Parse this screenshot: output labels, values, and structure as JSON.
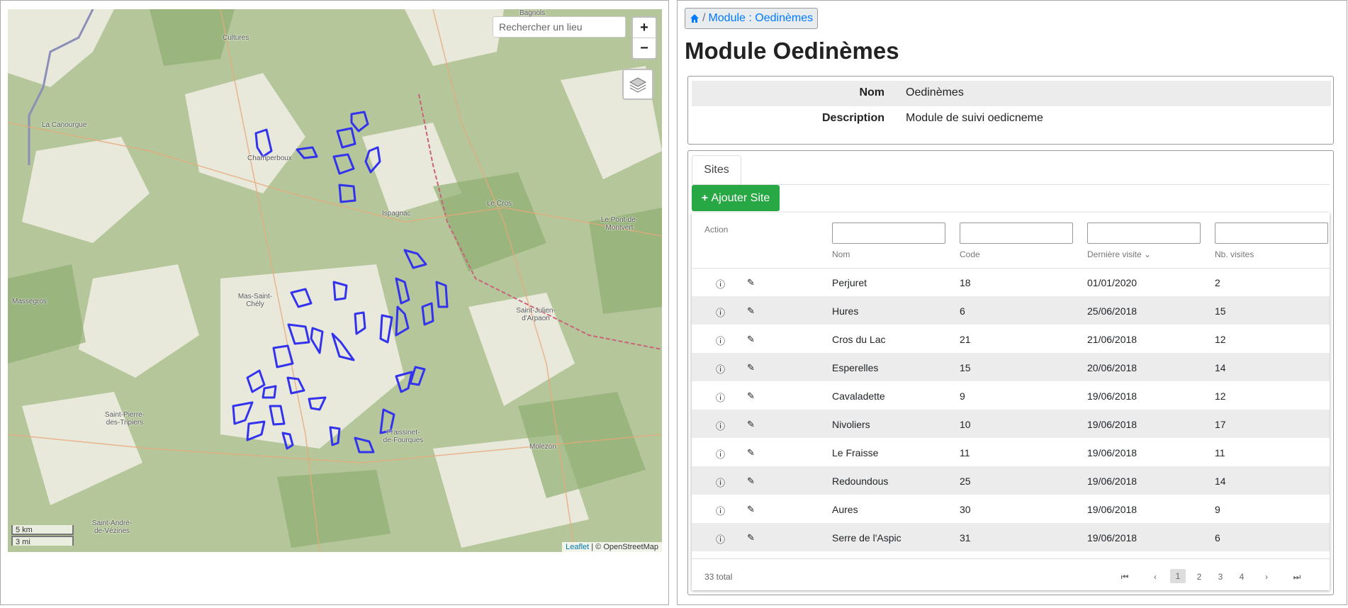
{
  "map": {
    "search_placeholder": "Rechercher un lieu",
    "zoom_in": "+",
    "zoom_out": "−",
    "scale_km": "5 km",
    "scale_mi": "3 mi",
    "attribution_leaflet": "Leaflet",
    "attribution_rest": " | © OpenStreetMap",
    "places": [
      "Cultures",
      "Bagnols",
      "La Canourgue",
      "Champerboux",
      "Ispagnac",
      "Le Cros",
      "Le Pont-de-Montvert",
      "Massegros",
      "Mas-Saint-Chély",
      "Saint-Julien-d'Arpaon",
      "Saint-Pierre-des-Tripiers",
      "Fraissinet-de-Fourques",
      "Molezon",
      "Saint-André-de-Vézines"
    ],
    "polygon_color": "#3333ee"
  },
  "breadcrumb": {
    "current": "Module : Oedinèmes",
    "separator": "/"
  },
  "title": "Module Oedinèmes",
  "info": {
    "nom_label": "Nom",
    "nom_value": "Oedinèmes",
    "desc_label": "Description",
    "desc_value": "Module de suivi oedicneme"
  },
  "tabs": {
    "sites": "Sites"
  },
  "add_button": "Ajouter Site",
  "table": {
    "headers": {
      "action": "Action",
      "nom": "Nom",
      "code": "Code",
      "derniere": "Dernière visite",
      "nb": "Nb. visites"
    },
    "rows": [
      {
        "nom": "Perjuret",
        "code": "18",
        "date": "01/01/2020",
        "nb": "2"
      },
      {
        "nom": "Hures",
        "code": "6",
        "date": "25/06/2018",
        "nb": "15"
      },
      {
        "nom": "Cros du Lac",
        "code": "21",
        "date": "21/06/2018",
        "nb": "12"
      },
      {
        "nom": "Esperelles",
        "code": "15",
        "date": "20/06/2018",
        "nb": "14"
      },
      {
        "nom": "Cavaladette",
        "code": "9",
        "date": "19/06/2018",
        "nb": "12"
      },
      {
        "nom": "Nivoliers",
        "code": "10",
        "date": "19/06/2018",
        "nb": "17"
      },
      {
        "nom": "Le Fraisse",
        "code": "11",
        "date": "19/06/2018",
        "nb": "11"
      },
      {
        "nom": "Redoundous",
        "code": "25",
        "date": "19/06/2018",
        "nb": "14"
      },
      {
        "nom": "Aures",
        "code": "30",
        "date": "19/06/2018",
        "nb": "9"
      },
      {
        "nom": "Serre de l'Aspic",
        "code": "31",
        "date": "19/06/2018",
        "nb": "6"
      }
    ],
    "total": "33 total",
    "pages": [
      "1",
      "2",
      "3",
      "4"
    ]
  },
  "colors": {
    "accent": "#007bff",
    "success": "#28a745"
  }
}
